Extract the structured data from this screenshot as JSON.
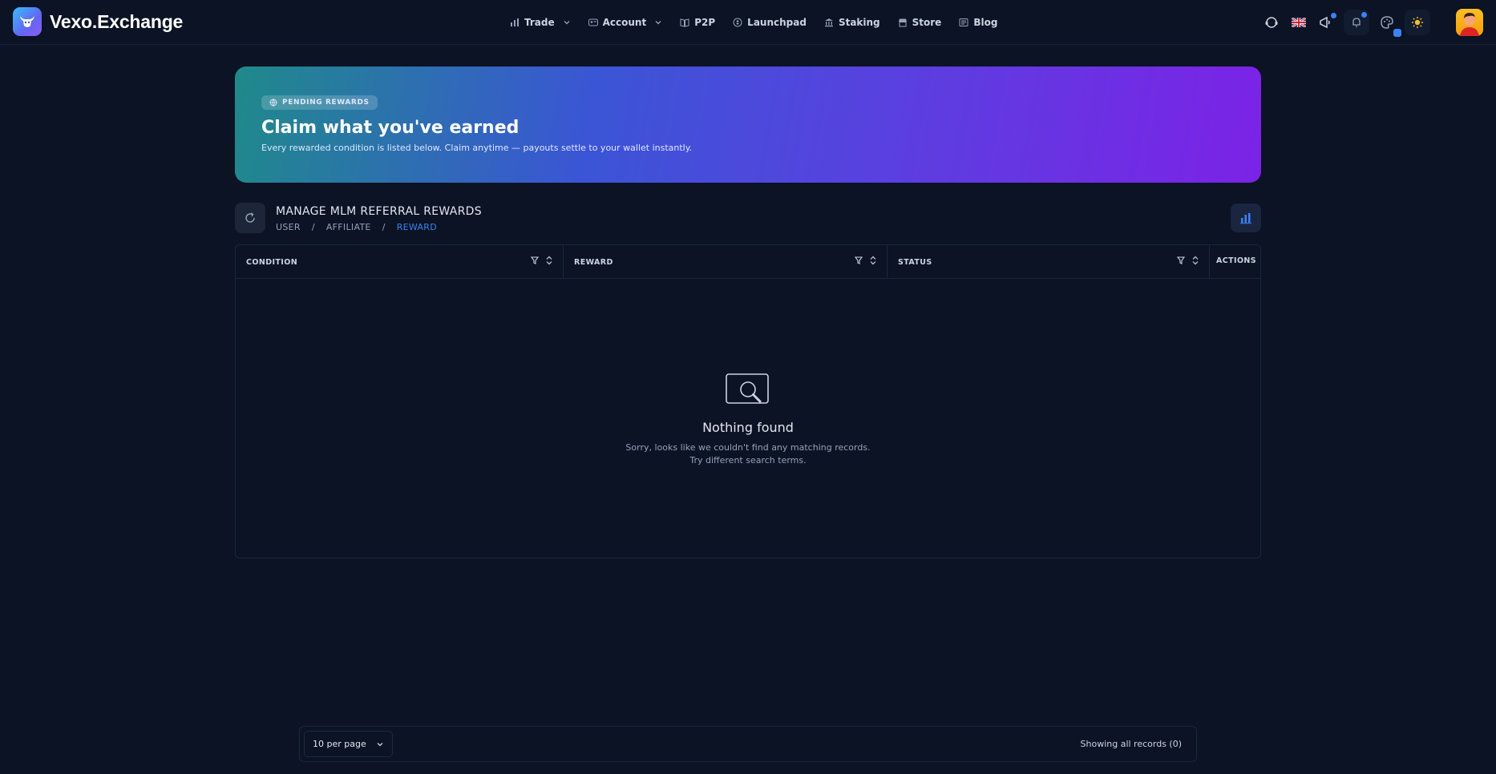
{
  "brand": {
    "name": "Vexo.Exchange"
  },
  "nav": {
    "items": [
      {
        "label": "Trade",
        "icon": "bar-chart-icon",
        "dropdown": true
      },
      {
        "label": "Account",
        "icon": "user-card-icon",
        "dropdown": true
      },
      {
        "label": "P2P",
        "icon": "book-icon",
        "dropdown": false
      },
      {
        "label": "Launchpad",
        "icon": "coin-icon",
        "dropdown": false
      },
      {
        "label": "Staking",
        "icon": "bank-icon",
        "dropdown": false
      },
      {
        "label": "Store",
        "icon": "store-icon",
        "dropdown": false
      },
      {
        "label": "Blog",
        "icon": "newspaper-icon",
        "dropdown": false
      }
    ]
  },
  "hero": {
    "badge": "PENDING REWARDS",
    "title": "Claim what you've earned",
    "subtitle": "Every rewarded condition is listed below. Claim anytime — payouts settle to your wallet instantly."
  },
  "page": {
    "title": "MANAGE MLM REFERRAL REWARDS",
    "breadcrumb": [
      "USER",
      "AFFILIATE",
      "REWARD"
    ],
    "separator": "/"
  },
  "table": {
    "columns": [
      "CONDITION",
      "REWARD",
      "STATUS",
      "ACTIONS"
    ],
    "empty": {
      "title": "Nothing found",
      "line1": "Sorry, looks like we couldn't find any matching records.",
      "line2": "Try different search terms."
    }
  },
  "footer": {
    "per_page": "10 per page",
    "records": "Showing all records (0)"
  },
  "colors": {
    "background": "#0b1324",
    "accent": "#3b82f6",
    "hero_start": "#1f8a8a",
    "hero_end": "#7c22e6"
  }
}
